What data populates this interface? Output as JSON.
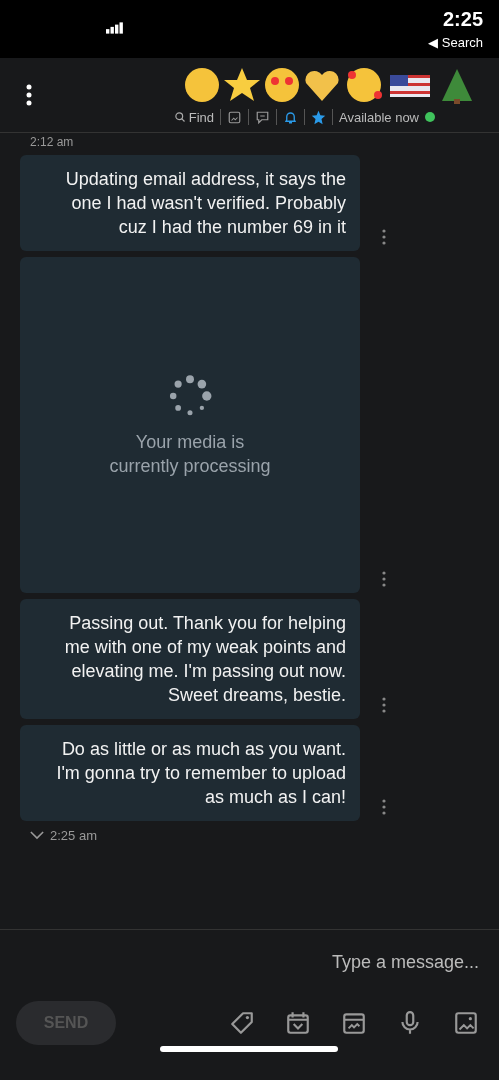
{
  "status_bar": {
    "time": "2:25",
    "back_label": "◀ Search"
  },
  "header": {
    "status": "Available now",
    "online": true,
    "find_label": "Find"
  },
  "timestamps_top": "2:12 am",
  "messages": [
    {
      "kind": "text",
      "text": "Updating email address, it says the one I had wasn't verified. Probably cuz I had the number 69 in it"
    },
    {
      "kind": "media",
      "text": "Your media is currently processing"
    },
    {
      "kind": "text",
      "text": "Passing out. Thank you for helping me with one of my weak points and elevating me. I'm passing out now. Sweet dreams, bestie."
    },
    {
      "kind": "text",
      "text": "Do as little or as much as you want. I'm gonna try to remember to upload as much as I can!"
    }
  ],
  "timestamp_bottom": "2:25 am",
  "composer": {
    "placeholder": "Type a message...",
    "send_label": "SEND",
    "send_disabled": true
  }
}
